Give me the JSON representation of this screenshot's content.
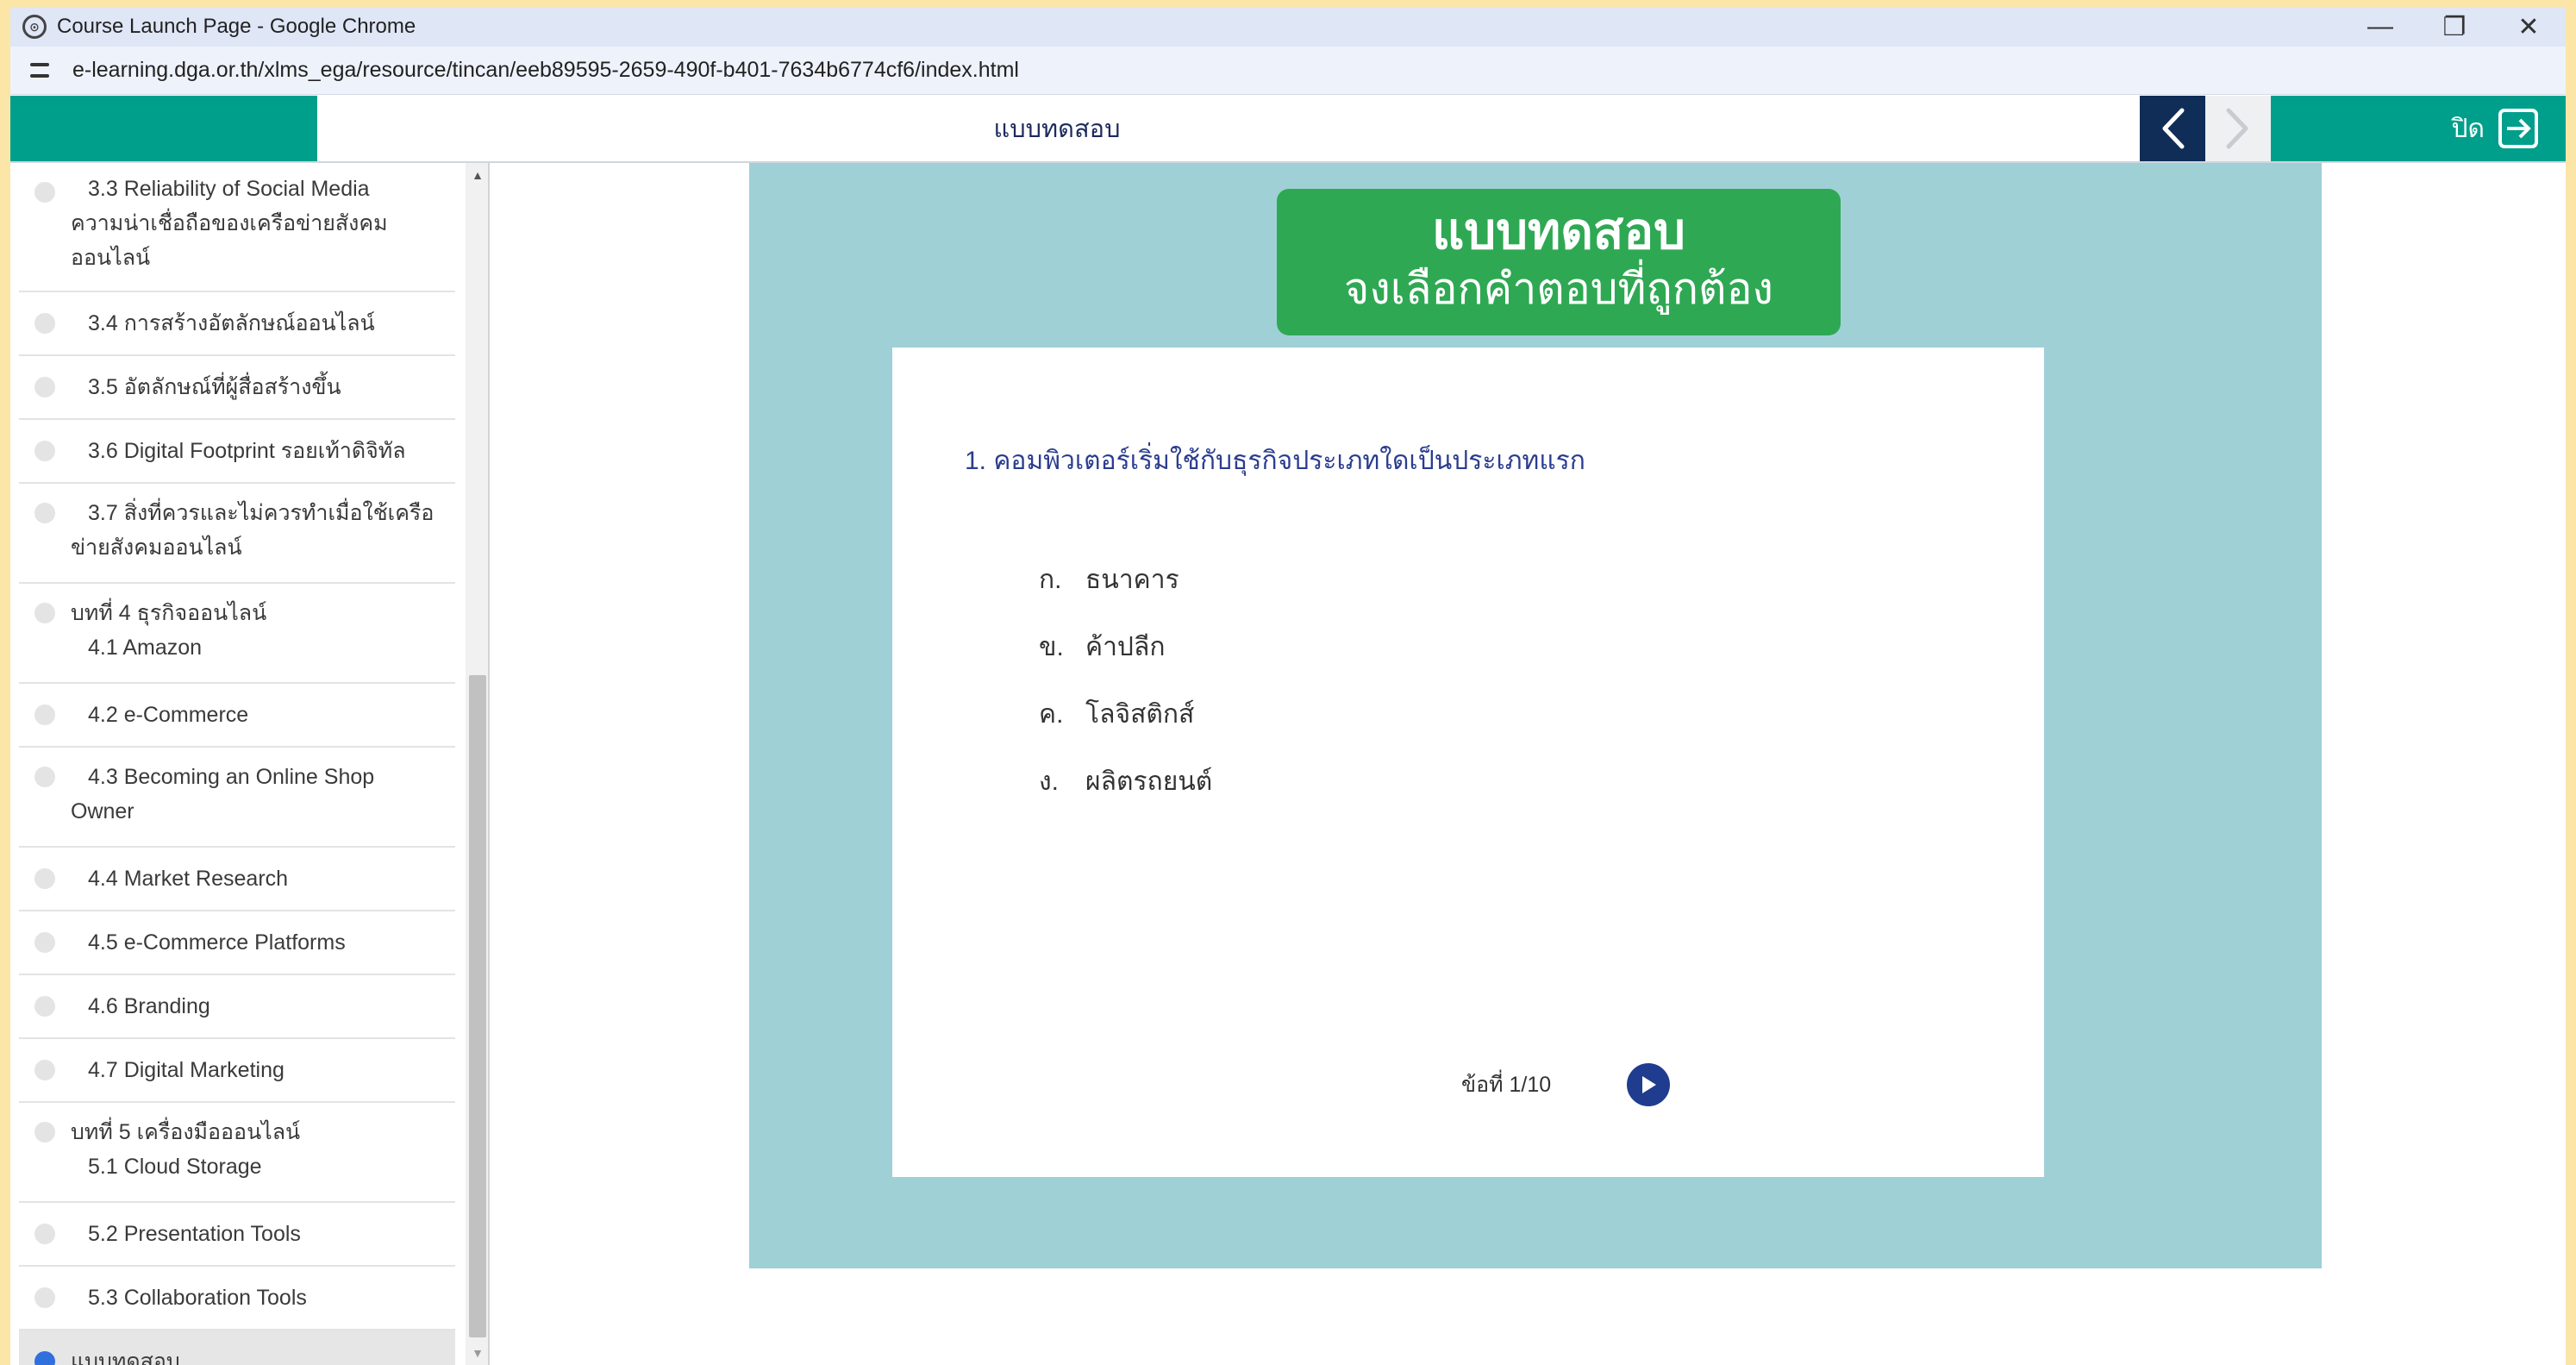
{
  "browser": {
    "tab_title": "Course Launch Page - Google Chrome",
    "url": "e-learning.dga.or.th/xlms_ega/resource/tincan/eeb89595-2659-490f-b401-7634b6774cf6/index.html",
    "controls": {
      "minimize": "—",
      "restore": "❐",
      "close": "✕"
    }
  },
  "header": {
    "title": "แบบทดสอบ",
    "close_label": "ปิด"
  },
  "sidebar": {
    "items": [
      {
        "lines": [
          "3.3 Reliability of Social Media",
          "ความน่าเชื่อถือของเครือข่ายสังคม",
          "ออนไลน์"
        ],
        "active": false
      },
      {
        "lines": [
          "3.4 การสร้างอัตลักษณ์ออนไลน์"
        ],
        "active": false
      },
      {
        "lines": [
          "3.5 อัตลักษณ์ที่ผู้สื่อสร้างขึ้น"
        ],
        "active": false
      },
      {
        "lines": [
          "3.6 Digital Footprint รอยเท้าดิจิทัล"
        ],
        "active": false
      },
      {
        "lines": [
          "3.7 สิ่งที่ควรและไม่ควรทำเมื่อใช้เครือ",
          "ข่ายสังคมออนไลน์"
        ],
        "active": false
      },
      {
        "lines": [
          "บทที่ 4 ธุรกิจออนไลน์",
          "4.1 Amazon"
        ],
        "active": false
      },
      {
        "lines": [
          "4.2 e-Commerce"
        ],
        "active": false
      },
      {
        "lines": [
          "4.3 Becoming an Online Shop",
          "Owner"
        ],
        "active": false
      },
      {
        "lines": [
          "4.4 Market Research"
        ],
        "active": false
      },
      {
        "lines": [
          "4.5 e-Commerce Platforms"
        ],
        "active": false
      },
      {
        "lines": [
          "4.6 Branding"
        ],
        "active": false
      },
      {
        "lines": [
          "4.7 Digital Marketing"
        ],
        "active": false
      },
      {
        "lines": [
          "บทที่ 5 เครื่องมือออนไลน์",
          "5.1 Cloud Storage"
        ],
        "active": false
      },
      {
        "lines": [
          "5.2 Presentation Tools"
        ],
        "active": false
      },
      {
        "lines": [
          "5.3 Collaboration Tools"
        ],
        "active": false
      },
      {
        "lines": [
          "แบบทดสอบ"
        ],
        "active": true
      }
    ]
  },
  "quiz": {
    "banner_title": "แบบทดสอบ",
    "banner_subtitle": "จงเลือกคำตอบที่ถูกต้อง",
    "question": "1. คอมพิวเตอร์เริ่มใช้กับธุรกิจประเภทใดเป็นประเภทแรก",
    "choices": [
      {
        "letter": "ก.",
        "text": "ธนาคาร"
      },
      {
        "letter": "ข.",
        "text": "ค้าปลีก"
      },
      {
        "letter": "ค.",
        "text": "โลจิสติกส์"
      },
      {
        "letter": "ง.",
        "text": "ผลิตรถยนต์"
      }
    ],
    "counter": "ข้อที่ 1/10"
  }
}
